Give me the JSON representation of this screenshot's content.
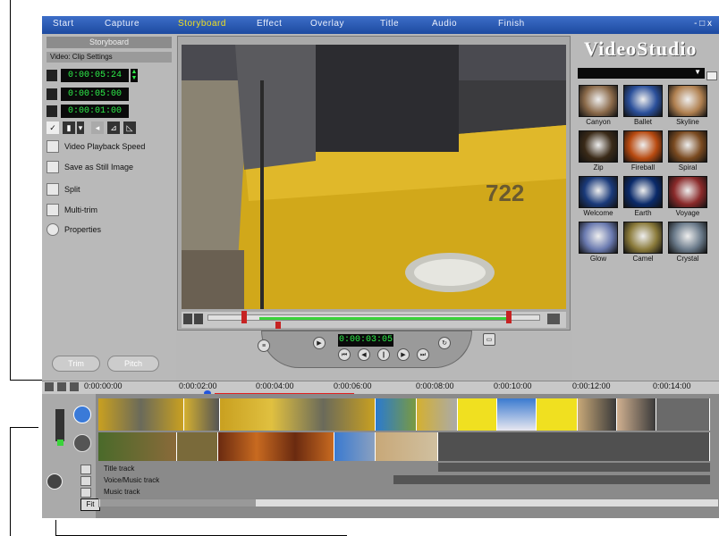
{
  "app": {
    "menu": [
      "Start",
      "Capture",
      "Storyboard",
      "Effect",
      "Overlay",
      "Title",
      "Audio",
      "Finish"
    ],
    "active_menu": "Storyboard",
    "window_buttons": "- □ x",
    "logo": "VideoStudio"
  },
  "left_panel": {
    "title": "Storyboard",
    "section": "Video: Clip Settings",
    "timecodes": [
      "0:00:05:24",
      "0:00:05:00",
      "0:00:01:00"
    ],
    "options": [
      "Video Playback Speed",
      "Save as Still Image",
      "Split",
      "Multi-trim",
      "Properties"
    ],
    "bottom_buttons": [
      "Trim",
      "Pitch"
    ]
  },
  "preview": {
    "timecode": "0:00:03:05"
  },
  "library": {
    "thumbs": [
      {
        "label": "Canyon",
        "color": "#8b6a4a"
      },
      {
        "label": "Ballet",
        "color": "#2a4f9a"
      },
      {
        "label": "Skyline",
        "color": "#b08050"
      },
      {
        "label": "Zip",
        "color": "#3a2a18"
      },
      {
        "label": "Fireball",
        "color": "#b84a10"
      },
      {
        "label": "Spiral",
        "color": "#7a4a20"
      },
      {
        "label": "Welcome",
        "color": "#1a3a7a"
      },
      {
        "label": "Earth",
        "color": "#0a2a6a"
      },
      {
        "label": "Voyage",
        "color": "#8a2a2a"
      },
      {
        "label": "Glow",
        "color": "#6a7ab0"
      },
      {
        "label": "Camel",
        "color": "#8a7a3a"
      },
      {
        "label": "Crystal",
        "color": "#6a7a8a"
      }
    ]
  },
  "timeline": {
    "ruler": [
      "0:00:00:00",
      "0:00:02:00",
      "0:00:04:00",
      "0:00:06:00",
      "0:00:08:00",
      "0:00:10:00",
      "0:00:12:00",
      "0:00:14:00"
    ],
    "tracks": [
      "Title track",
      "Voice/Music track",
      "Music track"
    ],
    "zoom": "Fit"
  }
}
